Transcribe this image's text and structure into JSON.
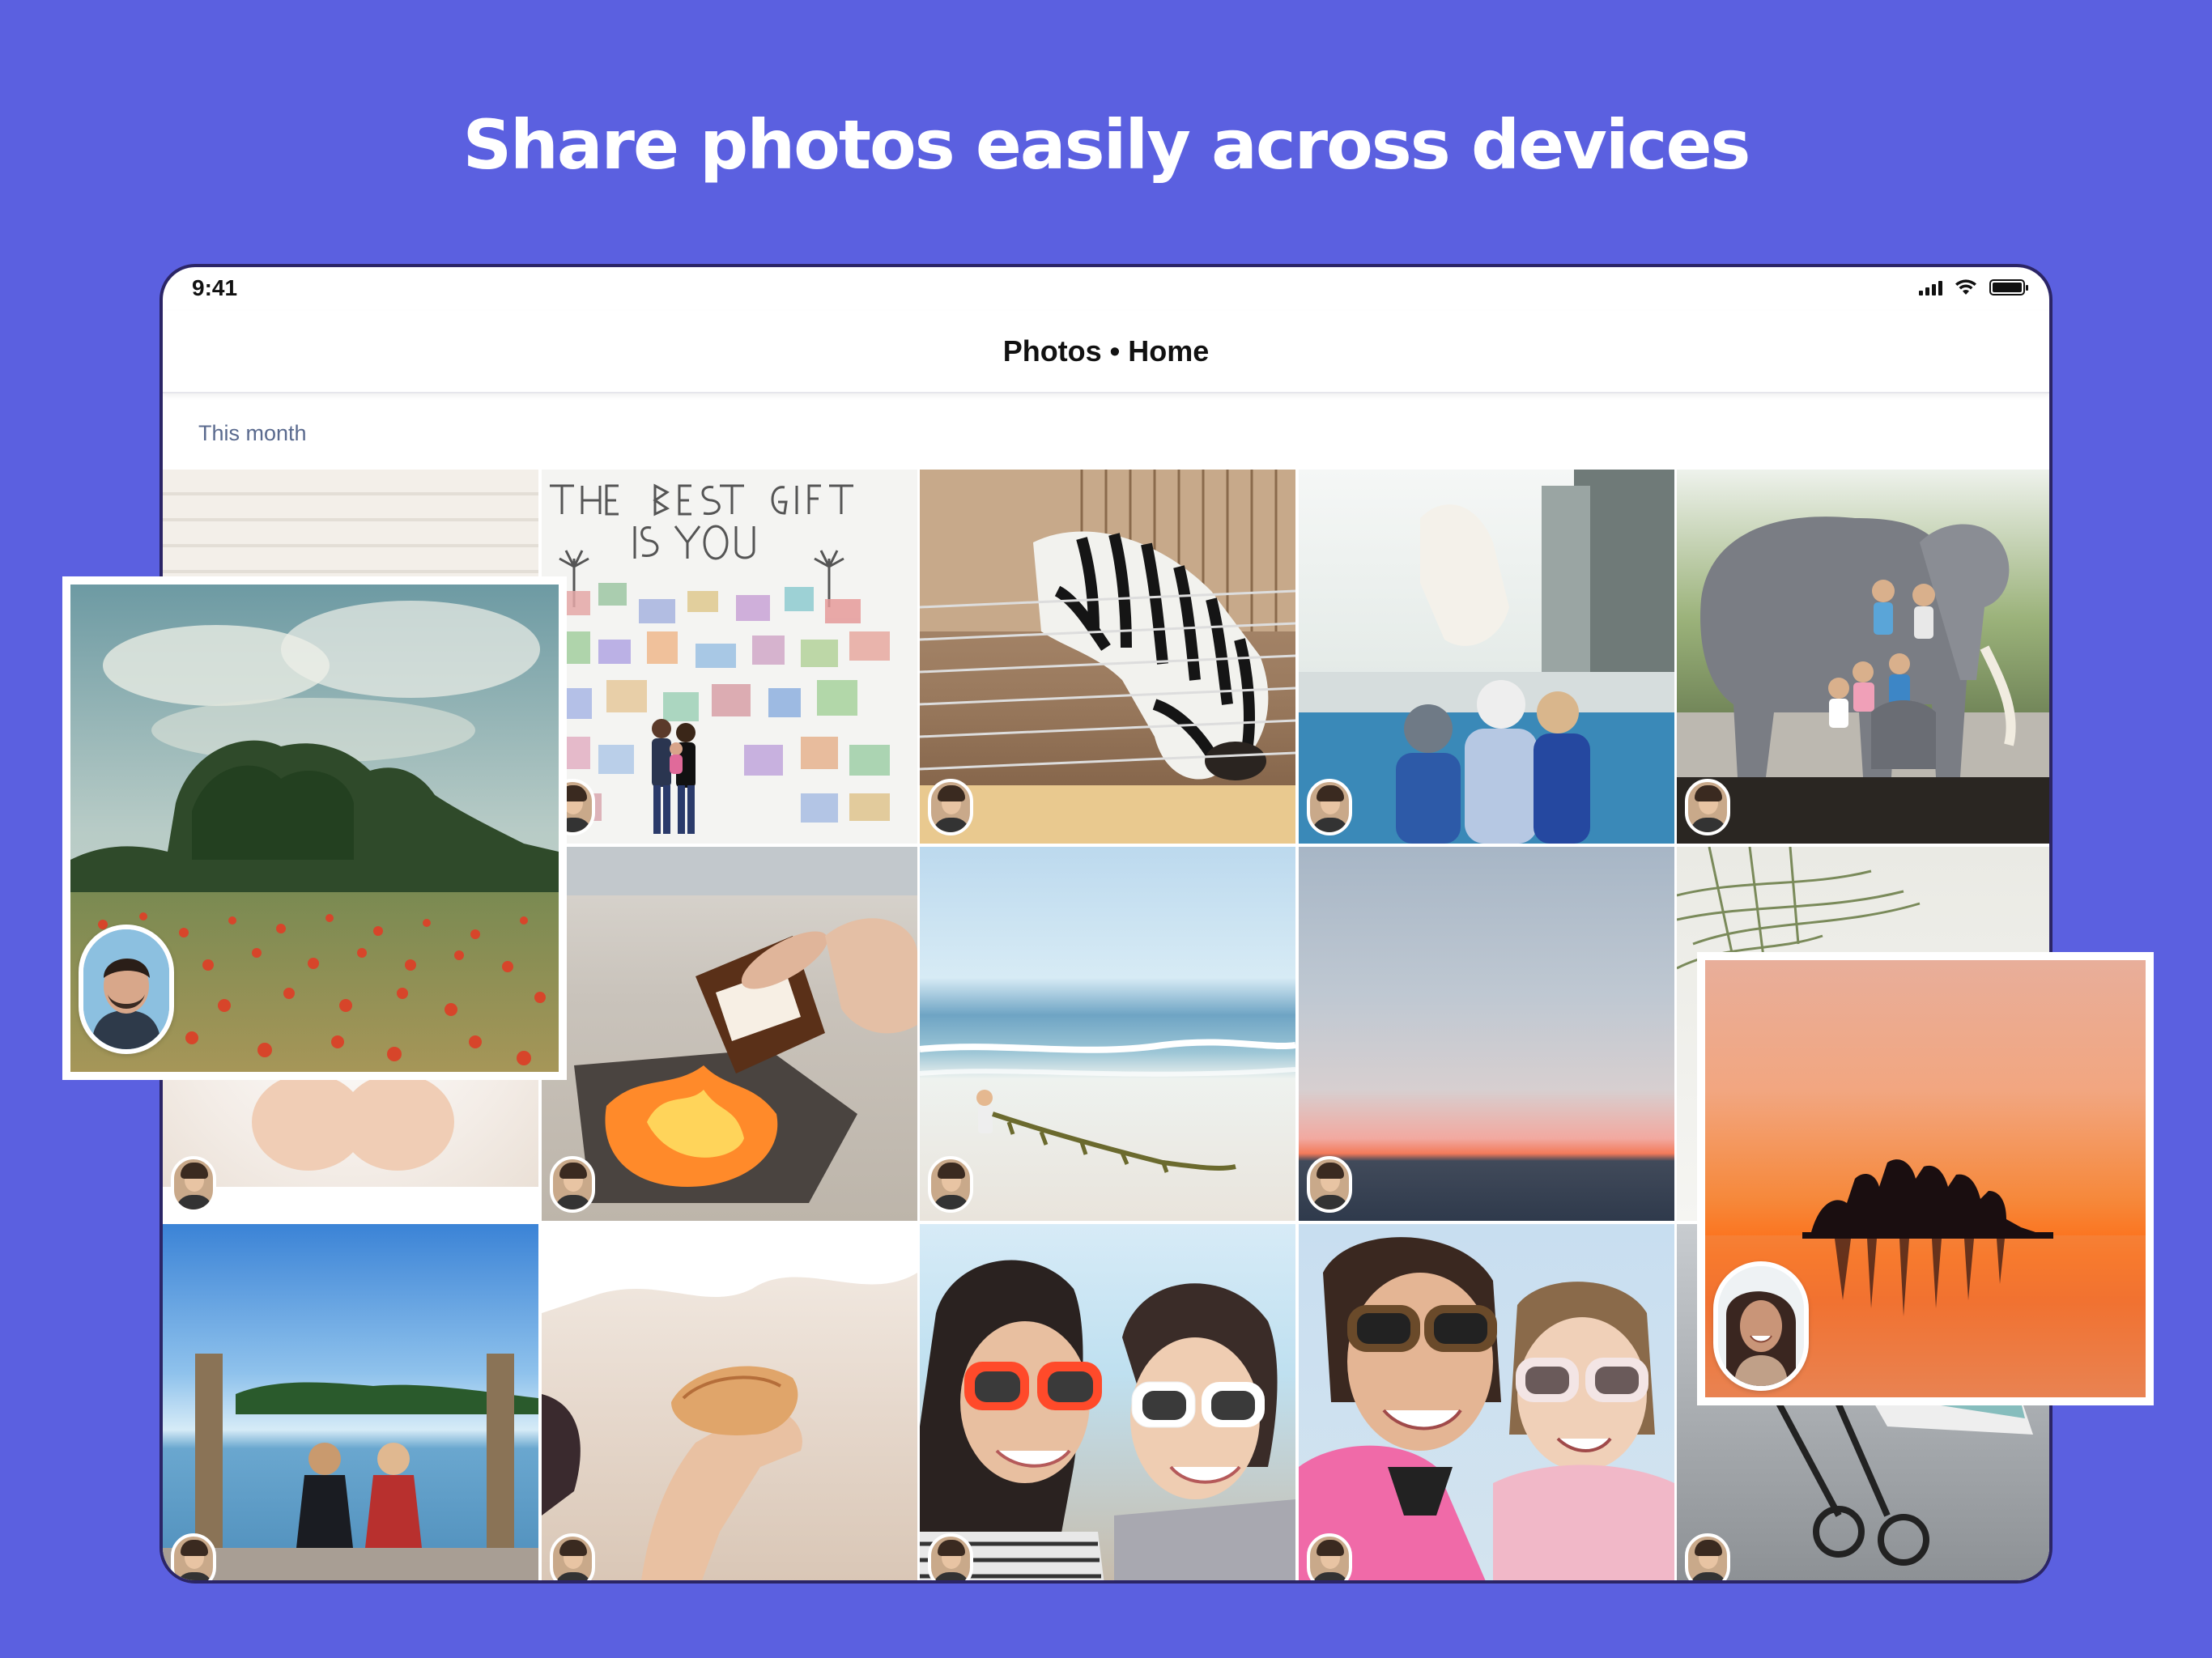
{
  "headline": "Share photos easily across devices",
  "status_bar": {
    "time": "9:41"
  },
  "nav": {
    "title": "Photos • Home"
  },
  "section": {
    "label": "This month"
  },
  "tiles": [
    {
      "name": "siding"
    },
    {
      "name": "best-gift-mural"
    },
    {
      "name": "zebra"
    },
    {
      "name": "polar-bear"
    },
    {
      "name": "elephant-statue"
    },
    {
      "name": "child-hands"
    },
    {
      "name": "smores-campfire"
    },
    {
      "name": "beach-seaweed"
    },
    {
      "name": "sunset-sky"
    },
    {
      "name": "dune-grass"
    },
    {
      "name": "dock-lake"
    },
    {
      "name": "seashell-hand"
    },
    {
      "name": "sunglasses-selfie"
    },
    {
      "name": "mom-daughter-selfie"
    },
    {
      "name": "stroller"
    }
  ],
  "colors": {
    "background": "#5b60e0",
    "device_frame": "#2b2566"
  }
}
